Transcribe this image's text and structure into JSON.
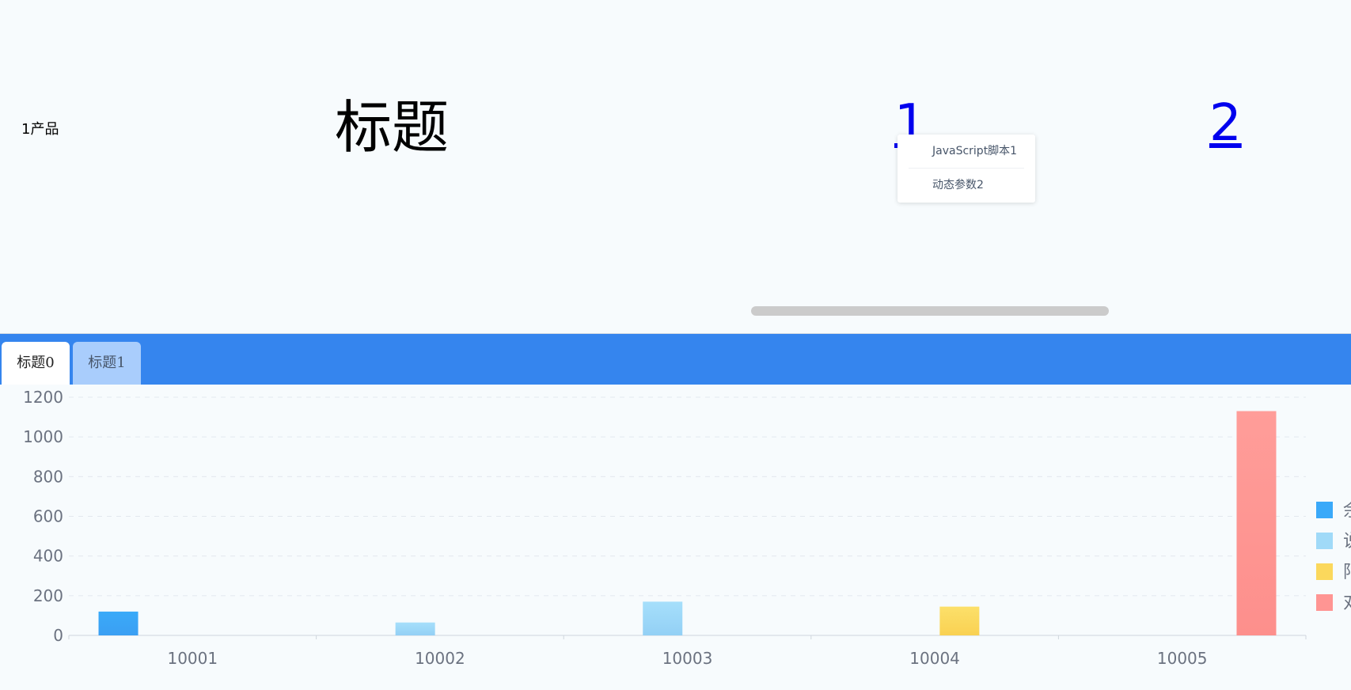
{
  "header": {
    "product_label": "1产品",
    "title": "标题",
    "links": [
      "1",
      "2"
    ]
  },
  "dropdown": {
    "items": [
      "JavaScript脚本1",
      "动态参数2"
    ]
  },
  "tabs": [
    {
      "label": "标题0",
      "active": true
    },
    {
      "label": "标题1",
      "active": false
    }
  ],
  "colors": {
    "tab_bar": "#3585ee",
    "tab_inactive": "#a9cdfc",
    "series": [
      "#3aa9f9",
      "#a0daf8",
      "#fbd85c",
      "#ff9593"
    ]
  },
  "chart_data": {
    "type": "bar",
    "categories": [
      "10001",
      "10002",
      "10003",
      "10004",
      "10005"
    ],
    "ylim": [
      0,
      1200
    ],
    "yticks": [
      0,
      200,
      400,
      600,
      800,
      1000,
      1200
    ],
    "grid": true,
    "legend_position": "right",
    "legend_labels": [
      "余",
      "说",
      "阳",
      "对"
    ],
    "series": [
      {
        "values": [
          120,
          0,
          0,
          0,
          0
        ]
      },
      {
        "values": [
          0,
          65,
          170,
          0,
          0
        ]
      },
      {
        "values": [
          0,
          0,
          0,
          145,
          0
        ]
      },
      {
        "values": [
          0,
          0,
          0,
          0,
          1130
        ]
      }
    ]
  }
}
